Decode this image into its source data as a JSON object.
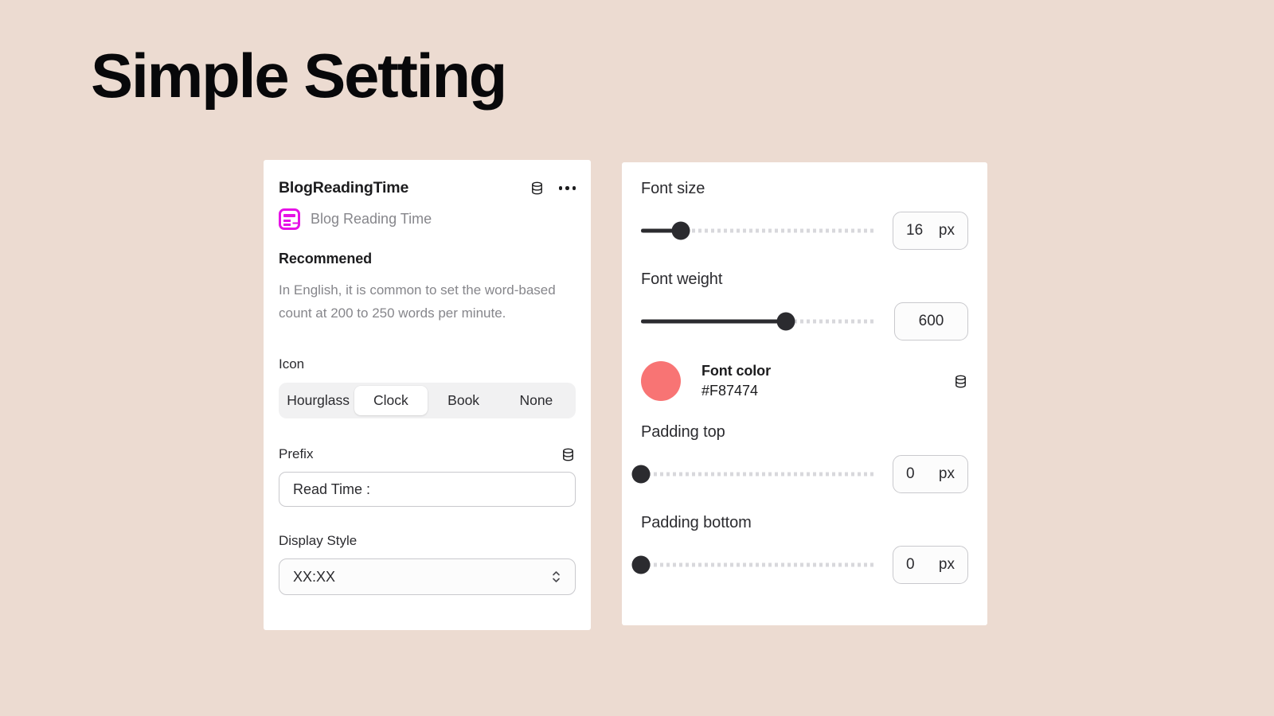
{
  "page": {
    "title": "Simple Setting",
    "background_color": "#ECDBD1"
  },
  "left_panel": {
    "title": "BlogReadingTime",
    "header_icons": {
      "database": "database-icon",
      "more": "more-options-icon"
    },
    "app_icon": "blog-card-icon",
    "subtitle": "Blog Reading Time",
    "recommended_heading": "Recommened",
    "description": "In English, it is common to set the word-based count at 200 to 250 words per minute.",
    "icon_field": {
      "label": "Icon",
      "options": [
        "Hourglass",
        "Clock",
        "Book",
        "None"
      ],
      "selected": "Clock"
    },
    "prefix_field": {
      "label": "Prefix",
      "value": "Read Time :",
      "placeholder": "Read Time :",
      "icon": "database-icon"
    },
    "display_style_field": {
      "label": "Display Style",
      "value": "XX:XX",
      "icon": "stepper-chevrons-icon"
    }
  },
  "right_panel": {
    "font_size": {
      "label": "Font size",
      "value": "16",
      "unit": "px",
      "fill_percent": 17
    },
    "font_weight": {
      "label": "Font weight",
      "value": "600",
      "unit": "",
      "fill_percent": 62
    },
    "font_color": {
      "label": "Font color",
      "hex": "#F87474",
      "swatch_color": "#F87474",
      "icon": "database-icon"
    },
    "padding_top": {
      "label": "Padding top",
      "value": "0",
      "unit": "px",
      "fill_percent": 0
    },
    "padding_bottom": {
      "label": "Padding bottom",
      "value": "0",
      "unit": "px",
      "fill_percent": 0
    }
  }
}
